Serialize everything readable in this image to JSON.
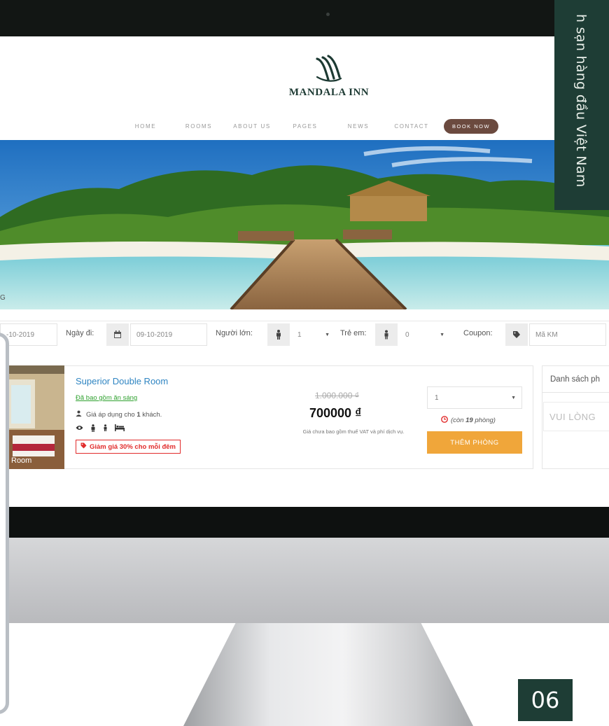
{
  "side_panel": {
    "text": "h sạn hàng đầu Việt Nam",
    "page_number": "06"
  },
  "brand": {
    "logo_text": "MANDALA INN"
  },
  "nav": {
    "items": [
      "HOME",
      "ROOMS",
      "ABOUT US",
      "PAGES",
      "NEWS",
      "CONTACT"
    ],
    "book_now": "BOOK NOW"
  },
  "section_heading_fragment": "G",
  "booking_form": {
    "checkin_value": "-10-2019",
    "checkout_label": "Ngày đi:",
    "checkout_value": "09-10-2019",
    "adults_label": "Người lớn:",
    "adults_value": "1",
    "children_label": "Trẻ em:",
    "children_value": "0",
    "coupon_label": "Coupon:",
    "coupon_placeholder": "Mã KM"
  },
  "room": {
    "photo_label": "Room",
    "title": "Superior Double Room",
    "included": "Đã bao gồm ăn sáng",
    "applies_prefix": "Giá áp dụng cho ",
    "applies_count": "1",
    "applies_suffix": " khách.",
    "discount": "Giảm giá 30% cho mỗi đêm",
    "old_price": "1.000.000 ₫",
    "new_price": "700000 ₫",
    "price_note": "Giá chưa bao gồm thuế VAT và phí dịch vụ.",
    "quantity_value": "1",
    "remaining_prefix": "(còn",
    "remaining_count": "19",
    "remaining_suffix": "phòng)",
    "add_button": "THÊM PHÒNG"
  },
  "cart": {
    "title": "Danh sách ph",
    "empty_text": "VUI LÒNG"
  },
  "colors": {
    "brand_dark": "#1e3d35",
    "accent_orange": "#f0a63a",
    "link_blue": "#2f85c2",
    "discount_red": "#e12b2b"
  }
}
